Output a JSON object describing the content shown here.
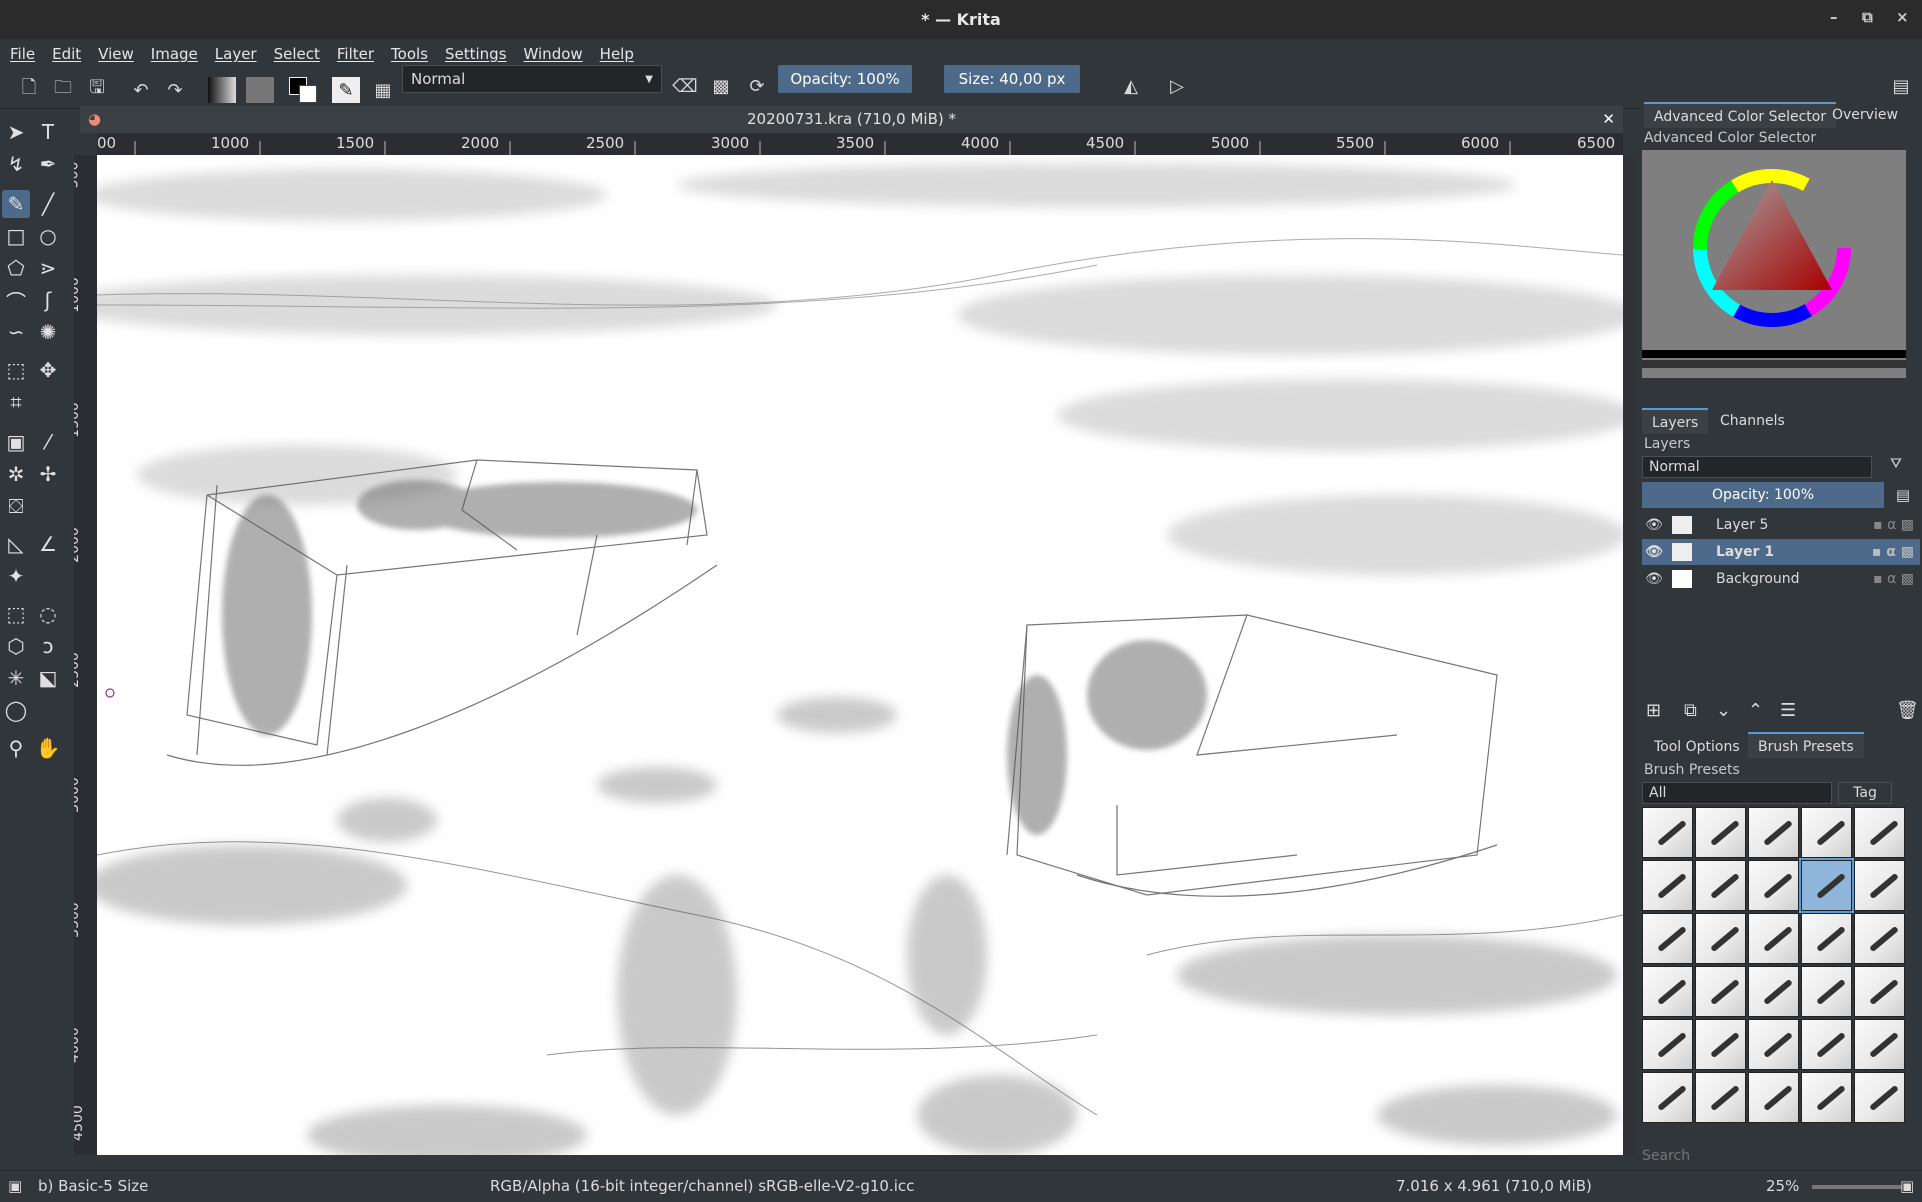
{
  "window": {
    "title": "* — Krita",
    "controls": [
      "–",
      "⧉",
      "×"
    ]
  },
  "menu": [
    "File",
    "Edit",
    "View",
    "Image",
    "Layer",
    "Select",
    "Filter",
    "Tools",
    "Settings",
    "Window",
    "Help"
  ],
  "toolbar": {
    "blend_mode": "Normal",
    "opacity_label": "Opacity: 100%",
    "size_label": "Size: 40,00 px"
  },
  "document": {
    "tab_title": "20200731.kra (710,0 MiB) *",
    "ruler_h": [
      "00",
      "1000",
      "1500",
      "2000",
      "2500",
      "3000",
      "3500",
      "4000",
      "4500",
      "5000",
      "5500",
      "6000",
      "6500"
    ],
    "ruler_v": [
      "500",
      "1000",
      "1500",
      "2000",
      "2500",
      "3000",
      "3500",
      "4000",
      "4500"
    ]
  },
  "dock": {
    "color_tabs": [
      "Advanced Color Selector",
      "Overview"
    ],
    "color_title": "Advanced Color Selector",
    "layer_tabs": [
      "Layers",
      "Channels"
    ],
    "layers_title": "Layers",
    "layer_blend": "Normal",
    "layer_opacity": "Opacity:  100%",
    "layers": [
      {
        "name": "Layer 5",
        "selected": false
      },
      {
        "name": "Layer 1",
        "selected": true
      },
      {
        "name": "Background",
        "selected": false
      }
    ],
    "brush_tabs": [
      "Tool Options",
      "Brush Presets"
    ],
    "brush_title": "Brush Presets",
    "brush_filter": "All",
    "brush_tag": "Tag",
    "search_placeholder": "Search"
  },
  "status": {
    "brush": "b) Basic-5 Size",
    "color_space": "RGB/Alpha (16-bit integer/channel)  sRGB-elle-V2-g10.icc",
    "dimensions": "7.016 x 4.961 (710,0 MiB)",
    "zoom": "25%"
  }
}
